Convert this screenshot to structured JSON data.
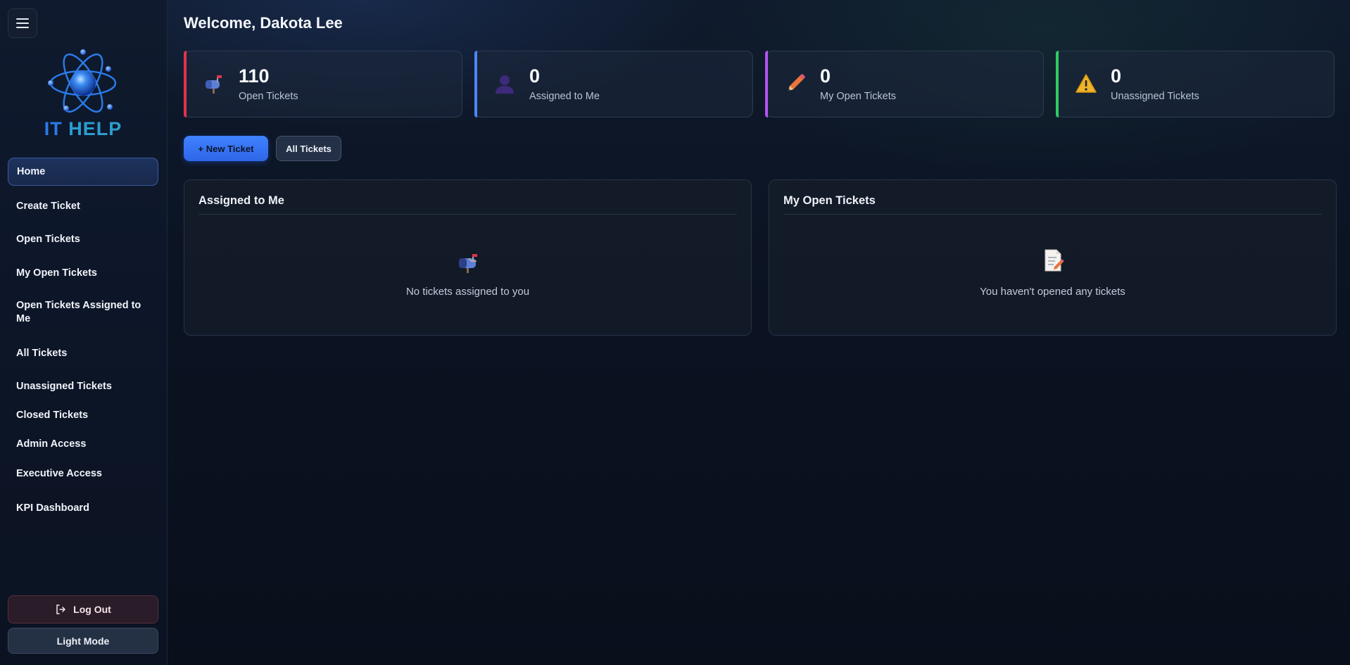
{
  "sidebar": {
    "logo": {
      "it": "IT",
      "help": "HELP"
    },
    "items": [
      {
        "label": "Home",
        "active": true
      },
      {
        "label": "Create Ticket"
      },
      {
        "label": "Open Tickets"
      },
      {
        "label": "My Open Tickets"
      },
      {
        "label": "Open Tickets Assigned to Me"
      },
      {
        "label": "All Tickets"
      },
      {
        "label": "Unassigned Tickets"
      },
      {
        "label": "Closed Tickets"
      },
      {
        "label": "Admin Access"
      },
      {
        "label": "Executive Access"
      },
      {
        "label": "KPI Dashboard"
      }
    ],
    "logout_label": "Log Out",
    "light_mode_label": "Light Mode"
  },
  "main": {
    "welcome": "Welcome, Dakota Lee",
    "stats": [
      {
        "value": "110",
        "label": "Open Tickets",
        "icon": "mailbox-icon",
        "color": "#e0344a"
      },
      {
        "value": "0",
        "label": "Assigned to Me",
        "icon": "person-icon",
        "color": "#4d86f5"
      },
      {
        "value": "0",
        "label": "My Open Tickets",
        "icon": "pencil-icon",
        "color": "#b552f0"
      },
      {
        "value": "0",
        "label": "Unassigned Tickets",
        "icon": "warning-icon",
        "color": "#2ecc65"
      }
    ],
    "new_ticket_label": "+ New Ticket",
    "all_tickets_label": "All Tickets",
    "panels": [
      {
        "title": "Assigned to Me",
        "icon": "mailbox-icon",
        "empty_message": "No tickets assigned to you"
      },
      {
        "title": "My Open Tickets",
        "icon": "memo-icon",
        "empty_message": "You haven't opened any tickets"
      }
    ]
  }
}
